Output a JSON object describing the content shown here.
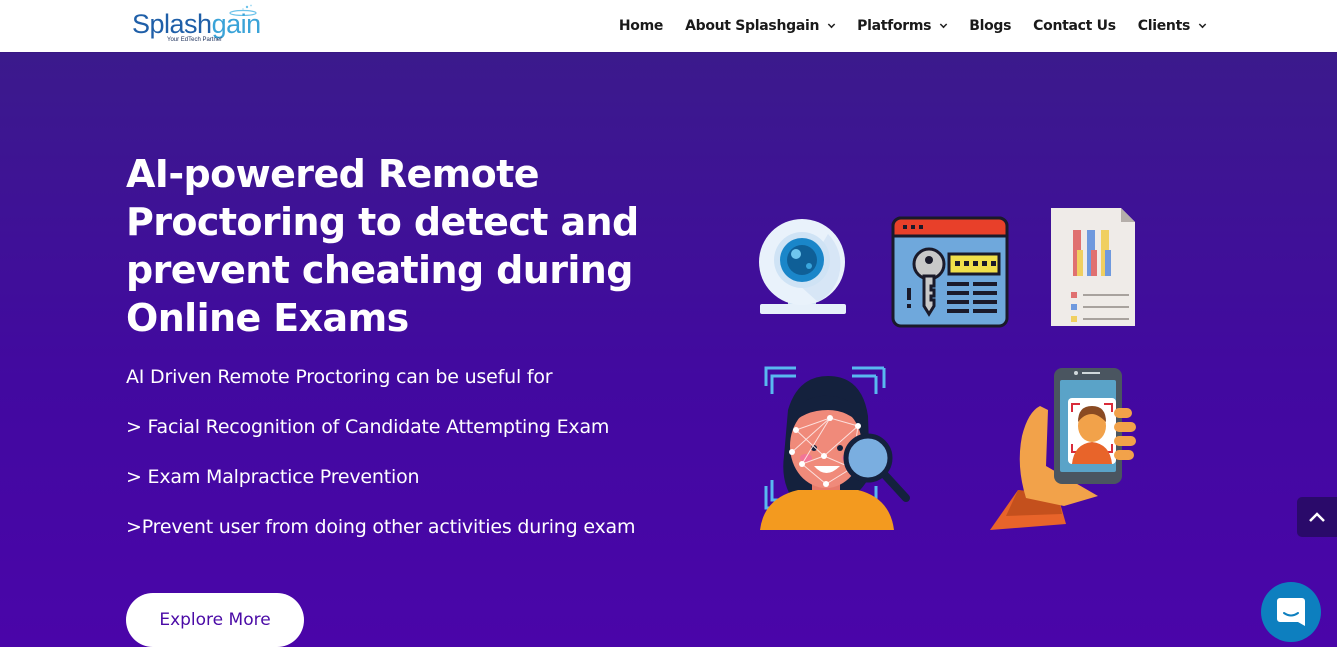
{
  "brand": {
    "name_part1": "Splash",
    "name_part2": "gain",
    "tagline": "Your EdTech Partner"
  },
  "nav": {
    "items": [
      {
        "label": "Home",
        "has_dropdown": false
      },
      {
        "label": "About Splashgain",
        "has_dropdown": true
      },
      {
        "label": "Platforms",
        "has_dropdown": true
      },
      {
        "label": "Blogs",
        "has_dropdown": false
      },
      {
        "label": "Contact Us",
        "has_dropdown": false
      },
      {
        "label": "Clients",
        "has_dropdown": true
      }
    ]
  },
  "hero": {
    "title": "AI-powered Remote Proctoring to detect and prevent cheating during Online Exams",
    "intro": "AI Driven Remote Proctoring can be useful for",
    "points": [
      "> Facial Recognition of Candidate Attempting Exam",
      "> Exam Malpractice Prevention",
      ">Prevent user from doing other activities during exam"
    ],
    "cta_label": "Explore More"
  },
  "illustrations": [
    "webcam-icon",
    "password-key-window-icon",
    "report-document-icon",
    "face-recognition-icon",
    "mobile-face-scan-icon"
  ],
  "colors": {
    "hero_top": "#3b1a8c",
    "hero_bottom": "#4a05a9",
    "cta_text": "#4a0aa6",
    "chat_button": "#0d7fbf",
    "back_to_top": "#2a0a6a"
  }
}
